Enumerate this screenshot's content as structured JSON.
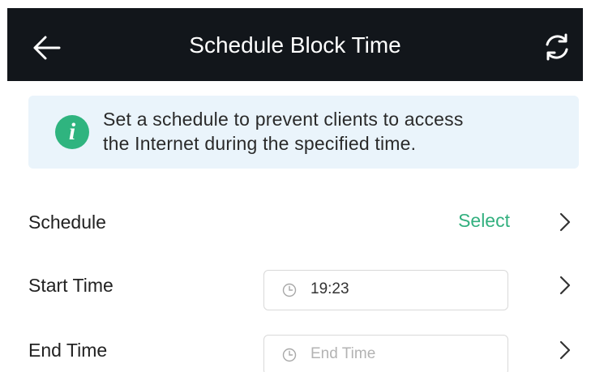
{
  "header": {
    "title": "Schedule Block Time",
    "back_icon": "back-arrow-icon",
    "refresh_icon": "refresh-icon",
    "background": "#12161b"
  },
  "info": {
    "icon": "info-icon",
    "icon_glyph": "i",
    "line1": "Set a schedule to prevent clients to access",
    "line2": "the Internet during the specified time.",
    "background": "#eaf4fb",
    "icon_color": "#2fb47f"
  },
  "form": {
    "schedule": {
      "label": "Schedule",
      "action": "Select",
      "action_color": "#33b07f"
    },
    "start_time": {
      "label": "Start Time",
      "value": "19:23"
    },
    "end_time": {
      "label": "End Time",
      "placeholder": "End Time"
    }
  }
}
